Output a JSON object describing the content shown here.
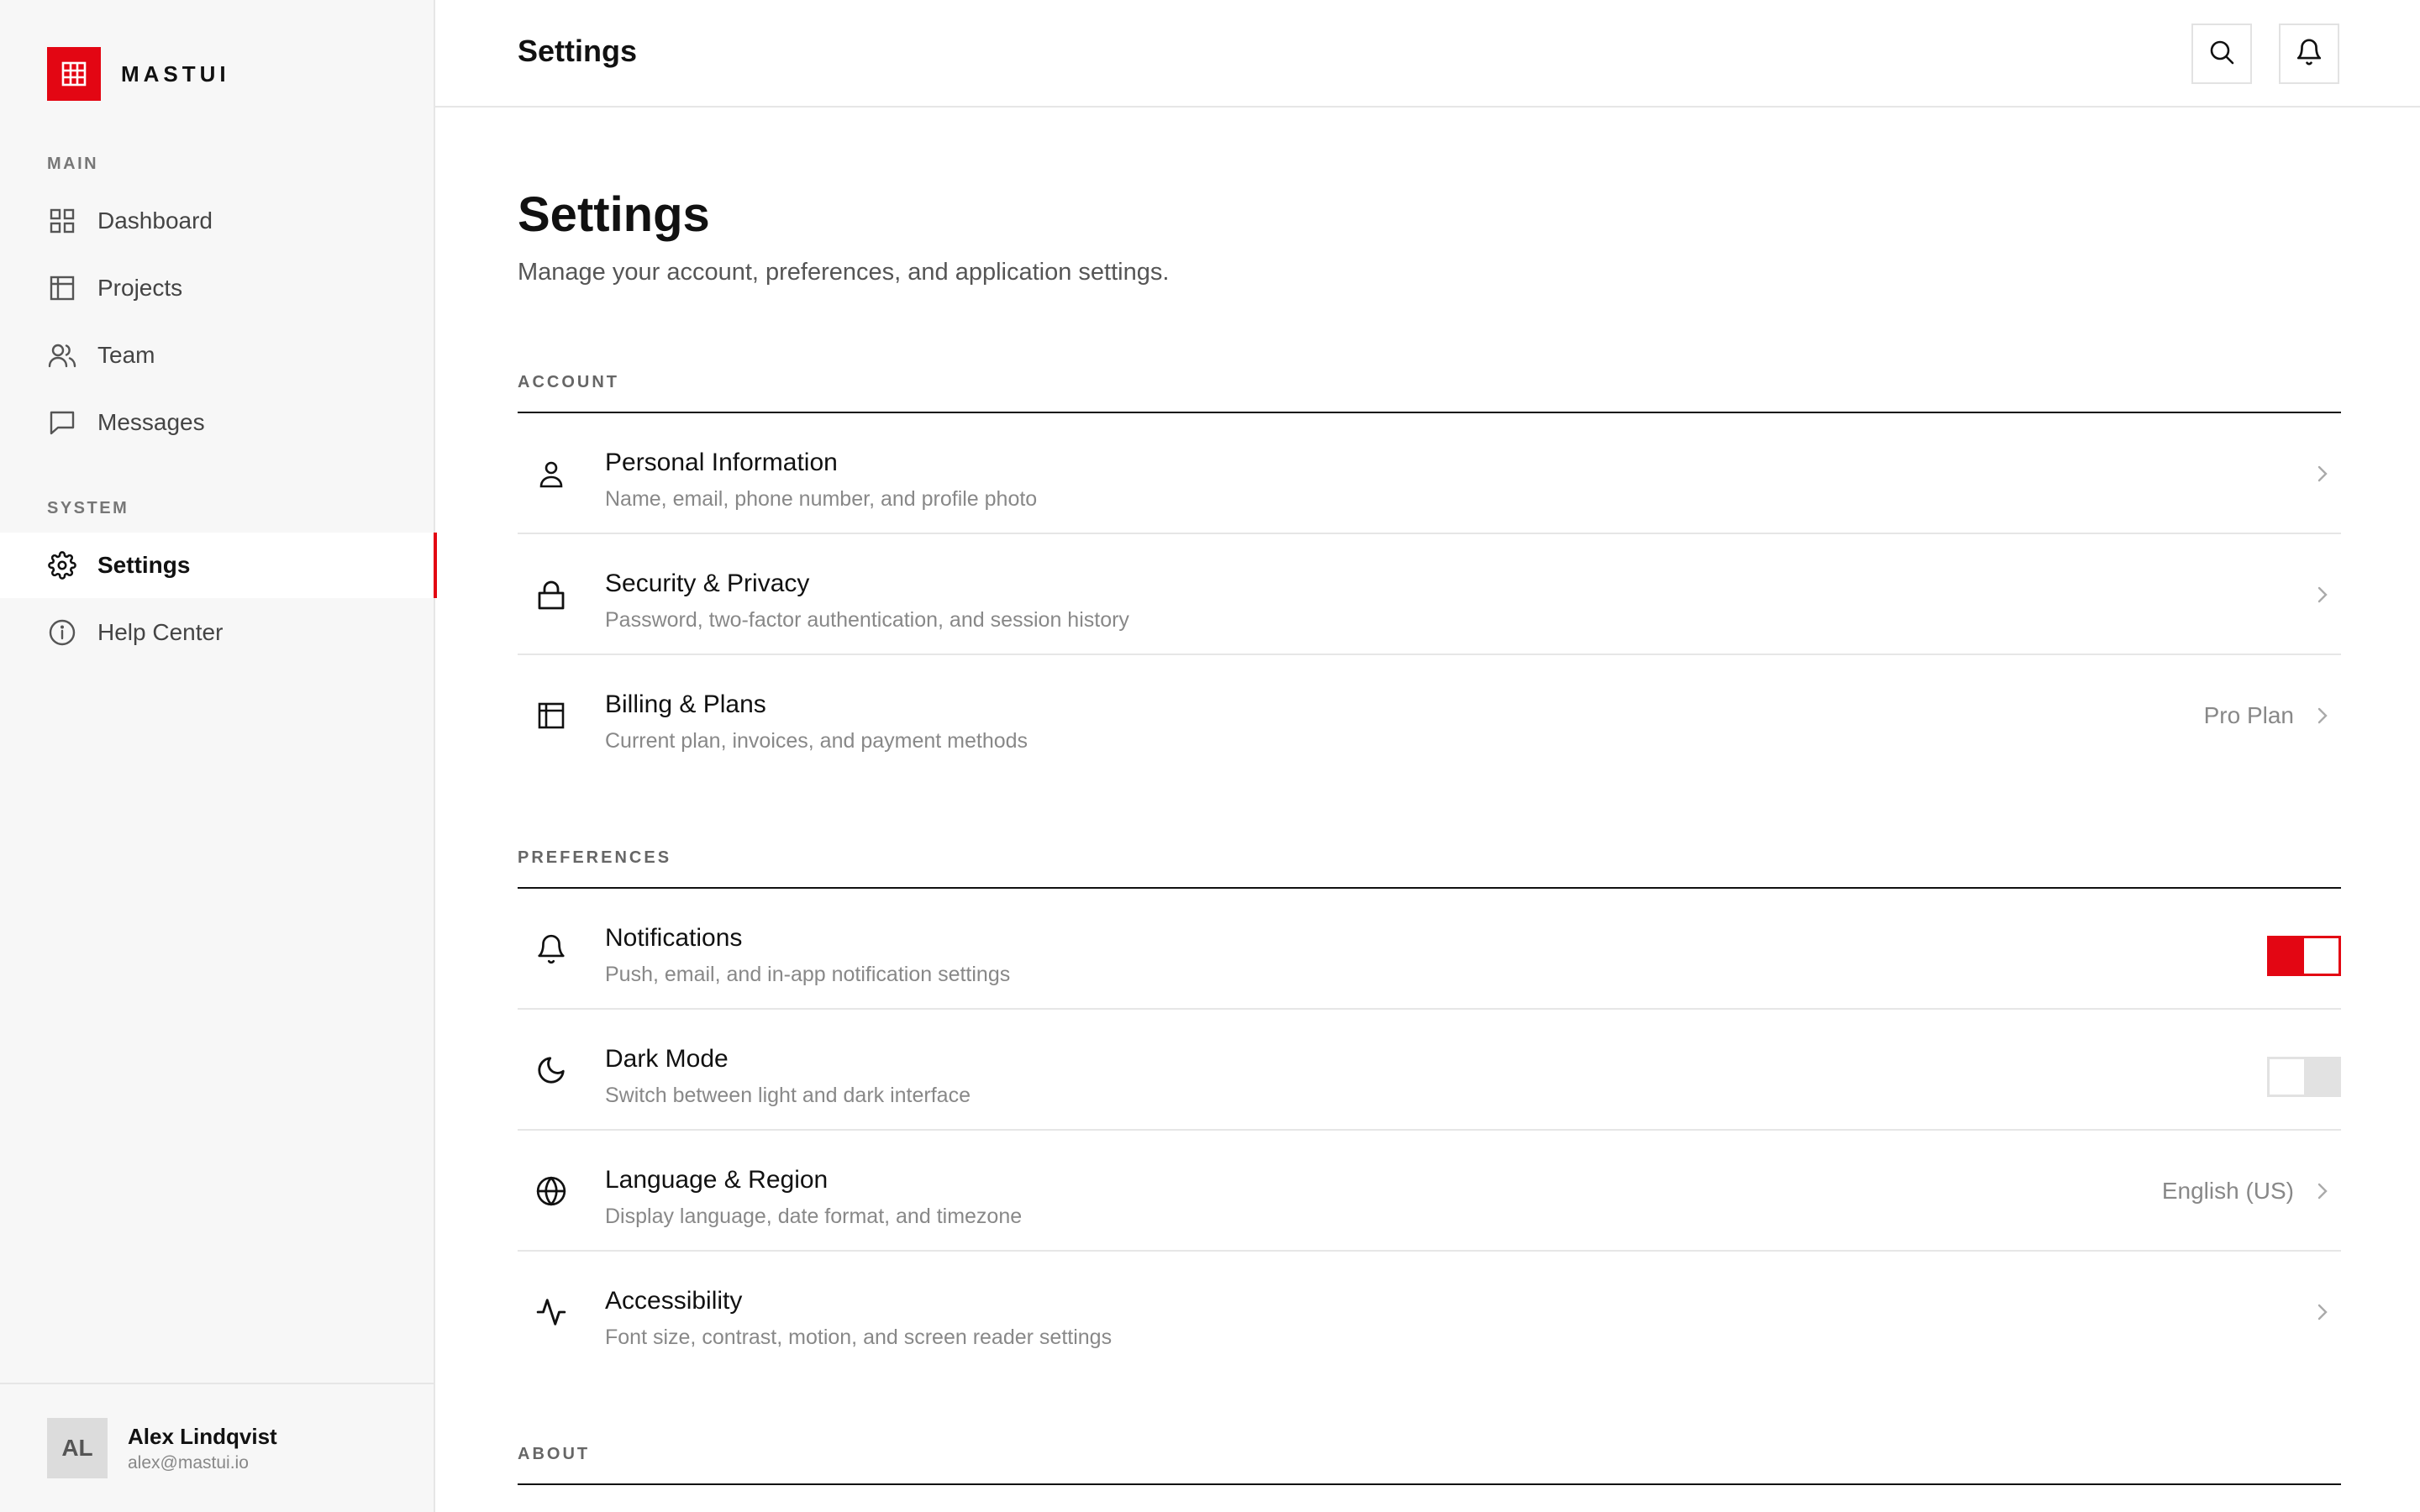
{
  "brand": {
    "name": "MASTUI"
  },
  "sidebar": {
    "main_label": "MAIN",
    "system_label": "SYSTEM",
    "items": [
      {
        "label": "Dashboard",
        "icon": "grid-icon"
      },
      {
        "label": "Projects",
        "icon": "layout-icon"
      },
      {
        "label": "Team",
        "icon": "users-icon"
      },
      {
        "label": "Messages",
        "icon": "message-icon"
      },
      {
        "label": "Settings",
        "icon": "gear-icon",
        "active": true
      },
      {
        "label": "Help Center",
        "icon": "info-icon"
      }
    ]
  },
  "user": {
    "initials": "AL",
    "name": "Alex Lindqvist",
    "email": "alex@mastui.io"
  },
  "topbar": {
    "title": "Settings"
  },
  "page": {
    "title": "Settings",
    "subtitle": "Manage your account, preferences, and application settings."
  },
  "sections": {
    "account": {
      "label": "ACCOUNT",
      "rows": [
        {
          "title": "Personal Information",
          "desc": "Name, email, phone number, and profile photo",
          "icon": "user-icon"
        },
        {
          "title": "Security & Privacy",
          "desc": "Password, two-factor authentication, and session history",
          "icon": "lock-icon"
        },
        {
          "title": "Billing & Plans",
          "desc": "Current plan, invoices, and payment methods",
          "value": "Pro Plan",
          "icon": "billing-icon"
        }
      ]
    },
    "preferences": {
      "label": "PREFERENCES",
      "rows": [
        {
          "title": "Notifications",
          "desc": "Push, email, and in-app notification settings",
          "toggle": true,
          "icon": "bell-icon"
        },
        {
          "title": "Dark Mode",
          "desc": "Switch between light and dark interface",
          "toggle": false,
          "icon": "moon-icon"
        },
        {
          "title": "Language & Region",
          "desc": "Display language, date format, and timezone",
          "value": "English (US)",
          "icon": "globe-icon"
        },
        {
          "title": "Accessibility",
          "desc": "Font size, contrast, motion, and screen reader settings",
          "icon": "activity-icon"
        }
      ]
    },
    "about": {
      "label": "ABOUT"
    }
  },
  "colors": {
    "accent": "#e30613",
    "sidebar_bg": "#f7f7f7",
    "border": "#e6e6e6",
    "muted": "#888888"
  }
}
